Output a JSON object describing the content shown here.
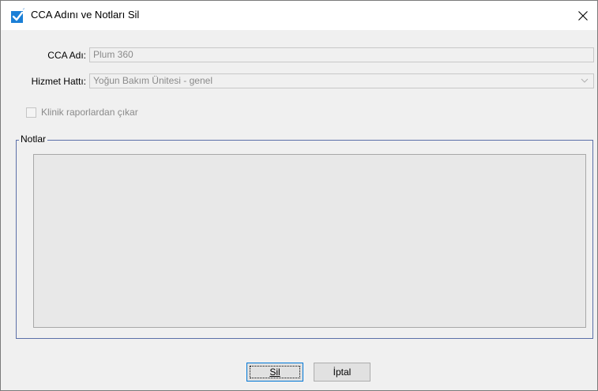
{
  "window": {
    "title": "CCA Adını ve Notları Sil",
    "icon": "checkbox-checked-icon",
    "close_icon": "close-icon",
    "accent_color": "#1b7fd6"
  },
  "form": {
    "cca_name_label": "CCA Adı:",
    "cca_name_value": "Plum 360",
    "service_line_label": "Hizmet Hattı:",
    "service_line_value": "Yoğun Bakım Ünitesi - genel",
    "exclude_checkbox_label": "Klinik raporlardan çıkar",
    "exclude_checked": false
  },
  "notes": {
    "group_title": "Notlar",
    "text": ""
  },
  "buttons": {
    "delete_label": "Sil",
    "cancel_label": "İptal"
  }
}
